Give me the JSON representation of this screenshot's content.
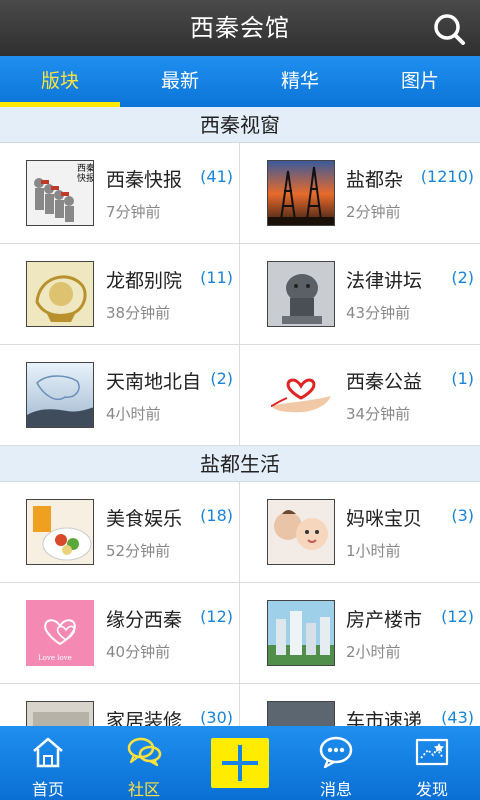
{
  "header": {
    "title": "西秦会馆",
    "search_icon": "search-icon"
  },
  "tabs": [
    {
      "label": "版块",
      "active": true
    },
    {
      "label": "最新",
      "active": false
    },
    {
      "label": "精华",
      "active": false
    },
    {
      "label": "图片",
      "active": false
    }
  ],
  "sections": [
    {
      "title": "西秦视窗",
      "items": [
        {
          "name": "西秦快报",
          "count": "(41)",
          "time": "7分钟前"
        },
        {
          "name": "盐都杂",
          "count": "(1210)",
          "time": "2分钟前"
        },
        {
          "name": "龙都别院",
          "count": "(11)",
          "time": "38分钟前"
        },
        {
          "name": "法律讲坛",
          "count": "(2)",
          "time": "43分钟前"
        },
        {
          "name": "天南地北自",
          "count": "(2)",
          "time": "4小时前"
        },
        {
          "name": "西秦公益",
          "count": "(1)",
          "time": "34分钟前"
        }
      ]
    },
    {
      "title": "盐都生活",
      "items": [
        {
          "name": "美食娱乐",
          "count": "(18)",
          "time": "52分钟前"
        },
        {
          "name": "妈咪宝贝",
          "count": "(3)",
          "time": "1小时前"
        },
        {
          "name": "缘分西秦",
          "count": "(12)",
          "time": "40分钟前"
        },
        {
          "name": "房产楼市",
          "count": "(12)",
          "time": "2小时前"
        },
        {
          "name": "家居装修",
          "count": "(30)",
          "time": ""
        },
        {
          "name": "车市速递",
          "count": "(43)",
          "time": ""
        }
      ]
    }
  ],
  "thumb_labels": {
    "news_sign": "西秦\n快报",
    "love_card": "Love love"
  },
  "bottom_nav": [
    {
      "label": "首页",
      "icon": "home-icon",
      "active": false
    },
    {
      "label": "社区",
      "icon": "chat-bubbles-icon",
      "active": true
    },
    {
      "label": "",
      "icon": "plus-icon",
      "active": false
    },
    {
      "label": "消息",
      "icon": "message-icon",
      "active": false
    },
    {
      "label": "发现",
      "icon": "map-flag-icon",
      "active": false
    }
  ],
  "colors": {
    "accent": "#ffe800",
    "bar_blue": "#1583e6",
    "count_blue": "#1a84d8",
    "title_bar": "#3a3a3a"
  }
}
